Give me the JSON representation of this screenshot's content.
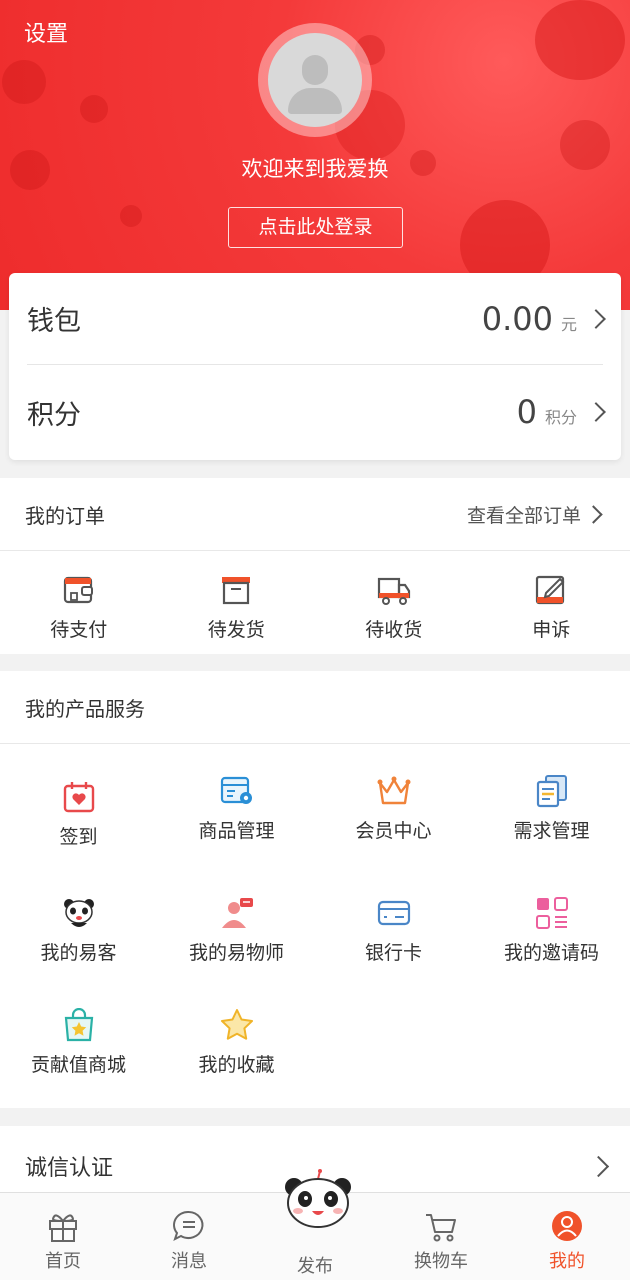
{
  "header": {
    "settings_label": "设置",
    "welcome_text": "欢迎来到我爱换",
    "login_button": "点击此处登录"
  },
  "account_card": {
    "wallet": {
      "label": "钱包",
      "value": "0.00",
      "unit": "元"
    },
    "points": {
      "label": "积分",
      "value": "0",
      "unit": "积分"
    }
  },
  "orders": {
    "title": "我的订单",
    "view_all": "查看全部订单",
    "items": [
      {
        "label": "待支付",
        "icon": "wallet-icon"
      },
      {
        "label": "待发货",
        "icon": "box-icon"
      },
      {
        "label": "待收货",
        "icon": "truck-icon"
      },
      {
        "label": "申诉",
        "icon": "edit-icon"
      }
    ]
  },
  "services": {
    "title": "我的产品服务",
    "items": [
      {
        "label": "签到",
        "icon": "calendar-heart-icon"
      },
      {
        "label": "商品管理",
        "icon": "store-settings-icon"
      },
      {
        "label": "会员中心",
        "icon": "crown-icon"
      },
      {
        "label": "需求管理",
        "icon": "documents-icon"
      },
      {
        "label": "我的易客",
        "icon": "panda-icon"
      },
      {
        "label": "我的易物师",
        "icon": "consultant-icon"
      },
      {
        "label": "银行卡",
        "icon": "bank-card-icon"
      },
      {
        "label": "我的邀请码",
        "icon": "qr-code-icon"
      },
      {
        "label": "贡献值商城",
        "icon": "shopping-bag-star-icon"
      },
      {
        "label": "我的收藏",
        "icon": "star-icon"
      }
    ]
  },
  "credit": {
    "label": "诚信认证"
  },
  "tabbar": {
    "items": [
      {
        "label": "首页",
        "icon": "gift-icon"
      },
      {
        "label": "消息",
        "icon": "chat-icon"
      },
      {
        "label": "发布",
        "icon": "panda-icon"
      },
      {
        "label": "换物车",
        "icon": "cart-icon"
      },
      {
        "label": "我的",
        "icon": "user-icon"
      }
    ],
    "active_index": 4
  },
  "colors": {
    "accent": "#f0522a",
    "header_red": "#f03535"
  }
}
